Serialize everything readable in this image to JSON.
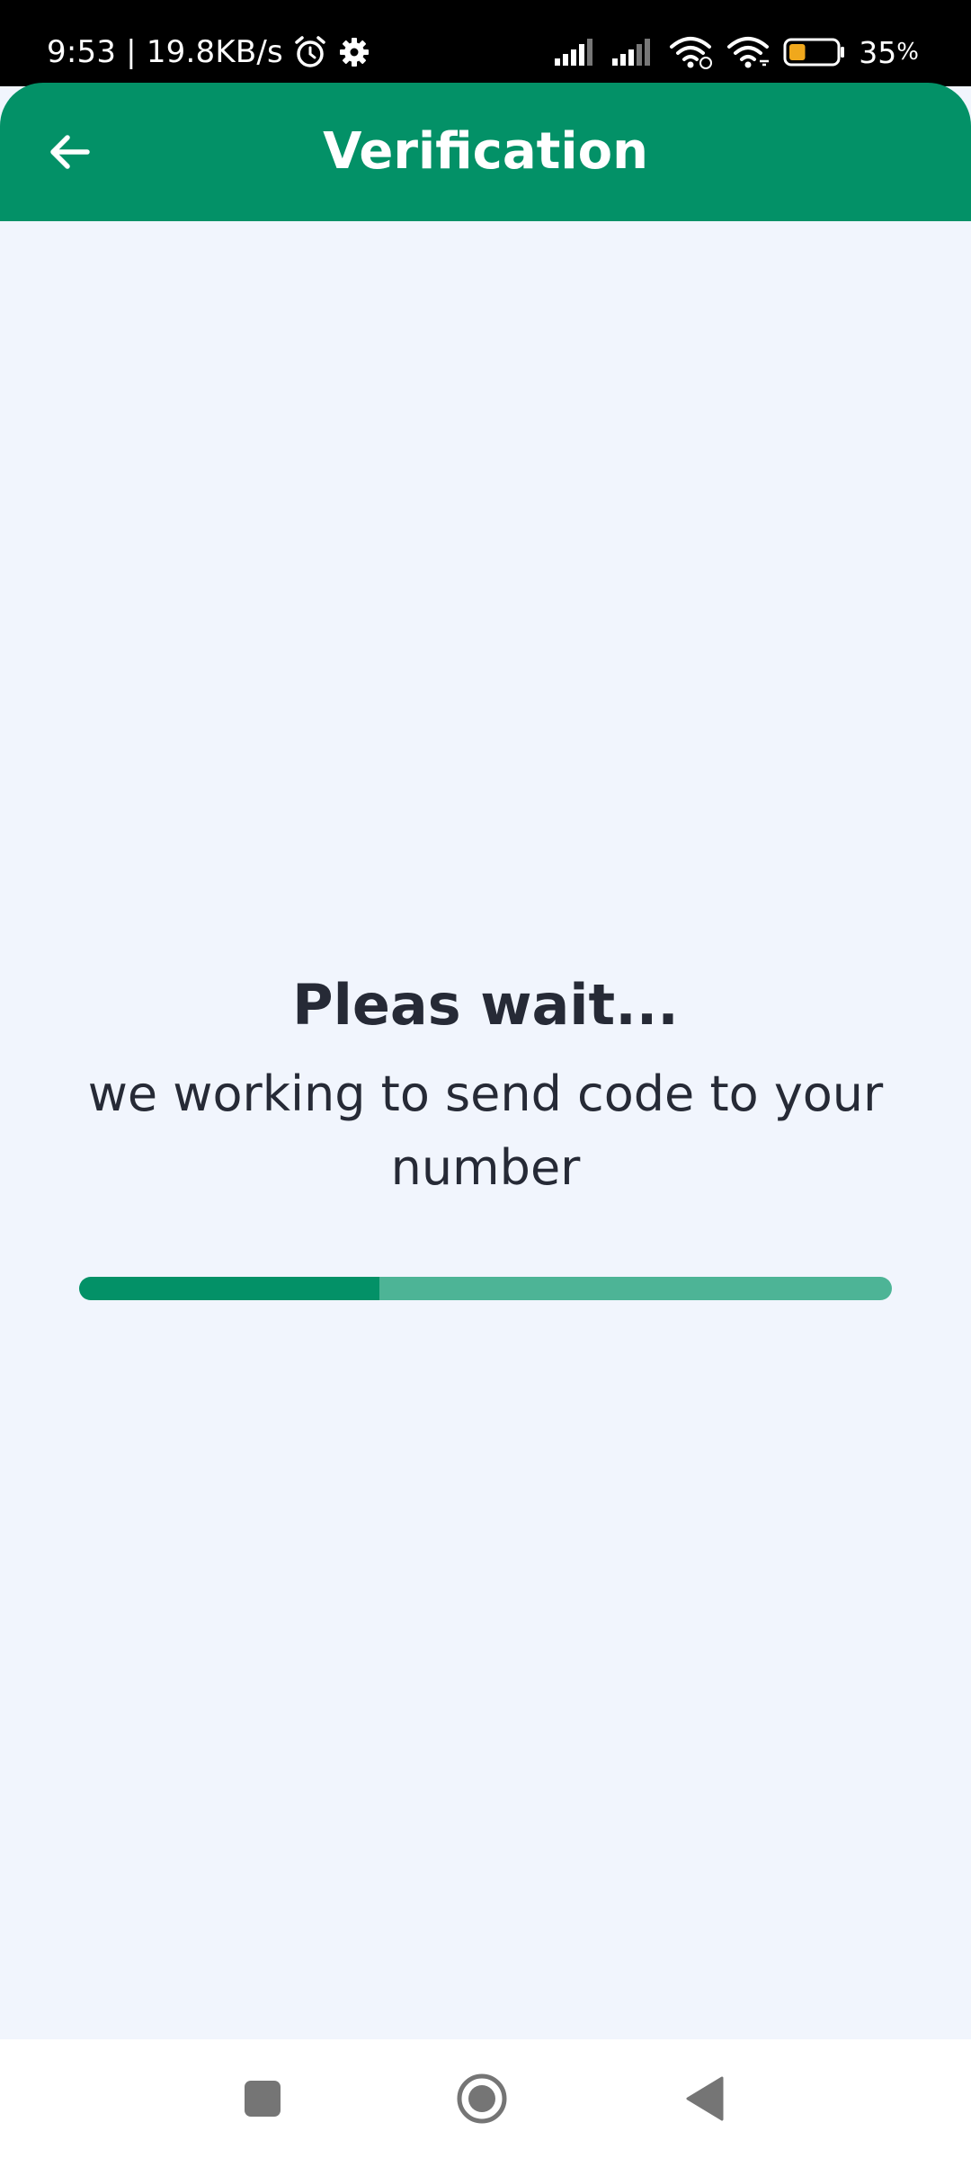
{
  "status_bar": {
    "time_and_speed": "9:53 | 19.8KB/s",
    "battery_percent": "35",
    "battery_unit": "%",
    "battery_level": 0.35,
    "icons": [
      "alarm-icon",
      "gear-icon",
      "signal-icon",
      "signal-icon",
      "wifi-icon",
      "wifi-icon",
      "battery-icon"
    ]
  },
  "app_bar": {
    "title": "Verification",
    "back_icon": "arrow-left-icon"
  },
  "main": {
    "title": "Pleas wait...",
    "subtitle": "we working to send code to your number",
    "progress": 0.37
  },
  "nav_bar": {
    "icons": [
      "recents-square-icon",
      "home-circle-icon",
      "back-triangle-icon"
    ]
  },
  "colors": {
    "accent": "#039167",
    "accent_light": "#4db496",
    "background": "#f1f5fd",
    "text": "#262a36"
  }
}
